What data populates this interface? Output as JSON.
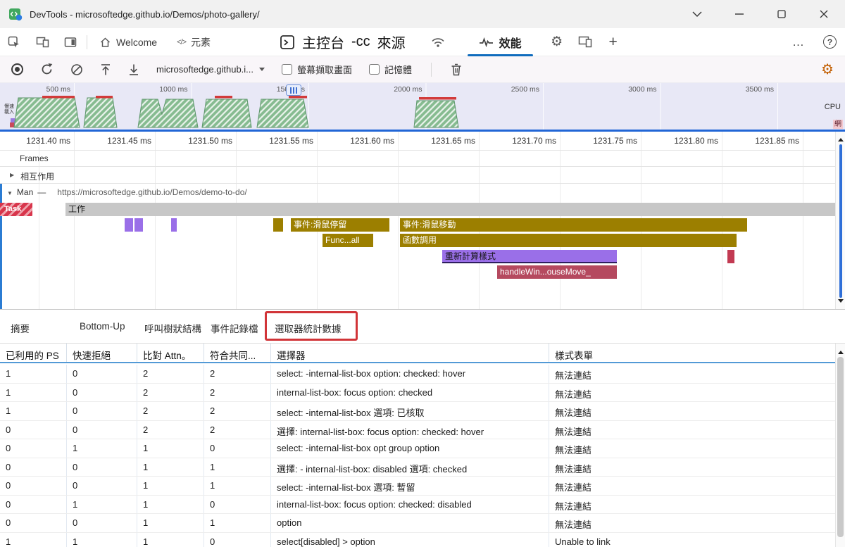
{
  "colors": {
    "accent_blue": "#0f6cbd",
    "range_blue": "#2166d6",
    "event_olive": "#9c7f00",
    "style_purple": "#9a6fe8",
    "js_crimson": "#b5495f",
    "cpu_green": "#86bb90",
    "task_red": "#d8354b",
    "highlight_red": "#d13438",
    "settings_orange": "#c25e00"
  },
  "titlebar": {
    "title": "DevTools - microsoftedge.github.io/Demos/photo-gallery/"
  },
  "tabbar": {
    "welcome": "Welcome",
    "elements_glyph": "</>",
    "elements": "元素",
    "console": "主控台",
    "cc": "-cc",
    "sources": "來源",
    "performance": "效能",
    "plus": "+",
    "more": "…",
    "help": "?"
  },
  "toolbar": {
    "site": "microsoftedge.github.i...",
    "screenshots": "螢幕擷取畫面",
    "memory": "記憶體"
  },
  "overview": {
    "times": [
      "500 ms",
      "1000 ms",
      "1500 ms",
      "2000 ms",
      "2500 ms",
      "3000 ms",
      "3500 ms"
    ],
    "cpu": "CPU",
    "net": "網",
    "left_label": "慢速載入"
  },
  "ruler": [
    "1231.40 ms",
    "1231.45 ms",
    "1231.50 ms",
    "1231.55 ms",
    "1231.60 ms",
    "1231.65 ms",
    "1231.70 ms",
    "1231.75 ms",
    "1231.80 ms",
    "1231.85 ms"
  ],
  "tracks": {
    "frames": "Frames",
    "interactions": "相互作用",
    "expand_collapsed": "▶",
    "expand_expanded": "▼",
    "main": "Man",
    "dash": "—",
    "url": "https://microsoftedge.github.io/Demos/demo-to-do/",
    "task_badge": "Task",
    "bars": {
      "task": "工作",
      "event_hover": "事件:滑鼠停留",
      "func_short": "Func...all",
      "event_move": "事件:滑鼠移動",
      "func_call": "函數調用",
      "recalc": "重新計算樣式",
      "handler": "handleWin...ouseMove_"
    }
  },
  "panels": {
    "tabs": [
      "摘要",
      "Bottom-Up",
      "呼叫樹狀結構",
      "事件記錄檔",
      "選取器統計數據"
    ]
  },
  "stats": {
    "columns": [
      "已利用的 PS",
      "快速拒絕",
      "比對 Attn。",
      "符合共同...",
      "選擇器",
      "樣式表單"
    ],
    "rows": [
      [
        "1",
        "0",
        "2",
        "2",
        "select: -internal-list-box option: checked: hover",
        "無法連結"
      ],
      [
        "1",
        "0",
        "2",
        "2",
        "internal-list-box: focus option: checked",
        "無法連結"
      ],
      [
        "1",
        "0",
        "2",
        "2",
        "select: -internal-list-box 選項: 已核取",
        "無法連結"
      ],
      [
        "0",
        "0",
        "2",
        "2",
        "選擇: internal-list-box: focus option: checked: hover",
        "無法連結"
      ],
      [
        "0",
        "1",
        "1",
        "0",
        "select: -internal-list-box opt group option",
        "無法連結"
      ],
      [
        "0",
        "0",
        "1",
        "1",
        "選擇: - internal-list-box: disabled 選項: checked",
        "無法連結"
      ],
      [
        "0",
        "0",
        "1",
        "1",
        "select: -internal-list-box 選項: 暫留",
        "無法連結"
      ],
      [
        "0",
        "1",
        "1",
        "0",
        "internal-list-box: focus option: checked: disabled",
        "無法連結"
      ],
      [
        "0",
        "0",
        "1",
        "1",
        "option",
        "無法連結"
      ],
      [
        "1",
        "1",
        "1",
        "0",
        "select[disabled] > option",
        "Unable to link"
      ]
    ]
  }
}
